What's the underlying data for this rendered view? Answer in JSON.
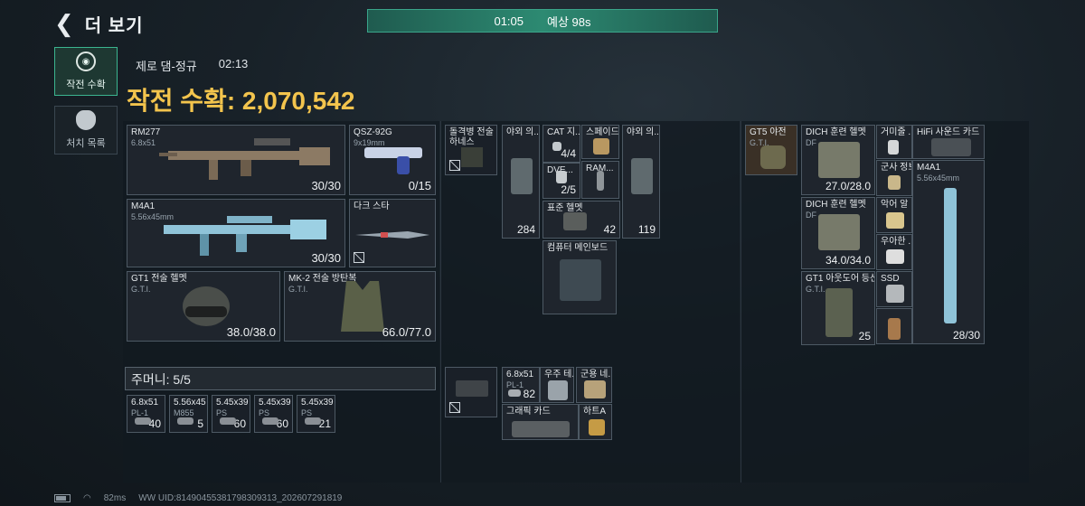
{
  "header": {
    "back_label": "더 보기",
    "timer": "01:05",
    "estimate": "예상 98s"
  },
  "tabs": [
    {
      "label": "작전 수확"
    },
    {
      "label": "처치 목록"
    }
  ],
  "match": {
    "map": "제로 댐-정규",
    "time": "02:13",
    "harvest_label": "작전 수확: 2,070,542"
  },
  "player": {
    "weapons": [
      {
        "name": "RM277",
        "caliber": "6.8x51",
        "ammo": "30/30"
      },
      {
        "name": "QSZ-92G",
        "caliber": "9x19mm",
        "ammo": "0/15"
      },
      {
        "name": "M4A1",
        "caliber": "5.56x45mm",
        "ammo": "30/30"
      },
      {
        "name": "다크 스타"
      }
    ],
    "helmet": {
      "name": "GT1 전술 헬멧",
      "brand": "G.T.I.",
      "durability": "38.0/38.0"
    },
    "armor": {
      "name": "MK-2 전술 방탄복",
      "brand": "G.T.I.",
      "durability": "66.0/77.0"
    },
    "pouch": {
      "label": "주머니: 5/5"
    },
    "pouch_items": [
      {
        "cal": "6.8x51",
        "type": "PL-1",
        "count": "40"
      },
      {
        "cal": "5.56x45",
        "type": "M855",
        "count": "5"
      },
      {
        "cal": "5.45x39",
        "type": "PS",
        "count": "60"
      },
      {
        "cal": "5.45x39",
        "type": "PS",
        "count": "60"
      },
      {
        "cal": "5.45x39",
        "type": "PS",
        "count": "21"
      }
    ]
  },
  "backpack": {
    "rig": {
      "name": "돌격병 전술 하네스"
    },
    "items": [
      {
        "name": "야외 의...",
        "count": "284"
      },
      {
        "name": "CAT 지...",
        "count": "4/4"
      },
      {
        "name": "스페이드..."
      },
      {
        "name": "야외 의...",
        "count": "119"
      },
      {
        "name": "DVE...",
        "count": "2/5"
      },
      {
        "name": "RAM..."
      },
      {
        "name": "표준 헬멧",
        "count": "42"
      },
      {
        "name": "컴퓨터 메인보드"
      }
    ],
    "bag": {
      "name": ""
    },
    "bag_items": [
      {
        "name": "6.8x51",
        "type": "PL-1",
        "count": "82"
      },
      {
        "name": "우주 테..."
      },
      {
        "name": "군용 네..."
      },
      {
        "name": "그래픽 카드"
      },
      {
        "name": "하트A"
      }
    ]
  },
  "loot": {
    "rig": {
      "name": "GT5 야전",
      "brand": "G.T.I."
    },
    "items": [
      {
        "name": "DICH 훈련 헬멧",
        "brand": "DF",
        "durability": "27.0/28.0"
      },
      {
        "name": "거미줄 ..."
      },
      {
        "name": "HiFi 사운드 카드"
      },
      {
        "name": "군사 정보"
      },
      {
        "name": "M4A1",
        "caliber": "5.56x45mm",
        "ammo": "28/30"
      },
      {
        "name": "DICH 훈련 헬멧",
        "brand": "DF",
        "durability": "34.0/34.0"
      },
      {
        "name": "악어 알"
      },
      {
        "name": "우아한 ..."
      },
      {
        "name": "GT1 아웃도어 등산...",
        "brand": "G.T.I.",
        "count": "25"
      },
      {
        "name": "SSD"
      },
      {
        "name": ""
      }
    ]
  },
  "footer": {
    "ping": "82ms",
    "uid": "WW UID:8149045538179830931​3_202607291819"
  },
  "colors": {
    "accent": "#3bb58f",
    "gold": "#f3c44d",
    "slot_bg": "#1f252d"
  }
}
